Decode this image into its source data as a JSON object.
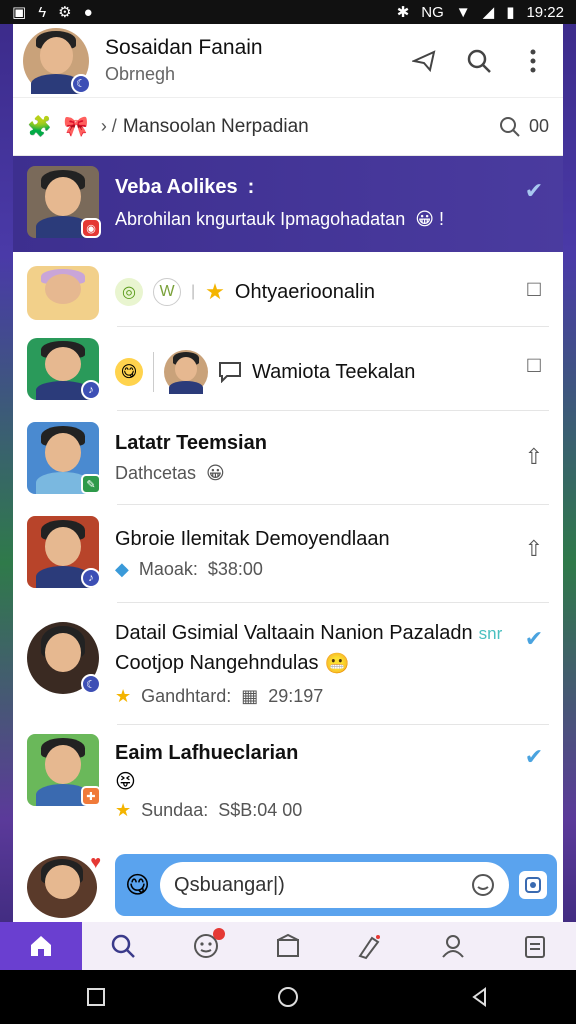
{
  "status": {
    "time": "19:22",
    "carrier": "NG"
  },
  "header": {
    "title": "Sosaidan Fanain",
    "subtitle": "Obrnegh"
  },
  "searchbar": {
    "query": "Mansoolan Nerpadian",
    "count": "00",
    "prefix": "› /"
  },
  "rows": [
    {
      "name": "row-1",
      "main": "Veba Aolikes",
      "main_suffix": ":",
      "sub": "Abrohilan kngurtauk Ipmagohadatan",
      "sub_emoji": "😀 !",
      "trail": "✔"
    },
    {
      "name": "row-2",
      "main": "Ohtyaerioonalin",
      "sub": "",
      "trail": "□"
    },
    {
      "name": "row-3",
      "main": "Wamiota Teekalan",
      "sub": "",
      "trail": "□"
    },
    {
      "name": "row-4",
      "main": "Latatr Teemsian",
      "sub": "Dathcetas",
      "trail": "⇧"
    },
    {
      "name": "row-5",
      "main": "Gbroie Ilemitak Demoyendlaan",
      "sub_prefix": "Maoak:",
      "sub": "$38:00",
      "trail": "⇧"
    },
    {
      "name": "row-6",
      "main": "Datail Gsimial Valtaain Nanion Pazaladn",
      "main_suffix": "snr",
      "main2": "Cootjop Nangehndulas",
      "sub_prefix": "Gandhtard:",
      "sub": "29:197",
      "trail": "✔"
    },
    {
      "name": "row-7",
      "main": "Eaim Lafhueclarian",
      "sub_prefix": "Sundaa:",
      "sub": "S$B:04 00",
      "trail": "✔"
    }
  ],
  "composer": {
    "placeholder": "Qsbuangar|)"
  },
  "nav": [
    "home",
    "search",
    "activity",
    "archive",
    "create",
    "profile",
    "clipboard"
  ],
  "colors": {
    "accent": "#6a3fd0",
    "highlight": "#3d2f8f",
    "composer": "#5aa3ee",
    "check": "#4aa3df"
  }
}
